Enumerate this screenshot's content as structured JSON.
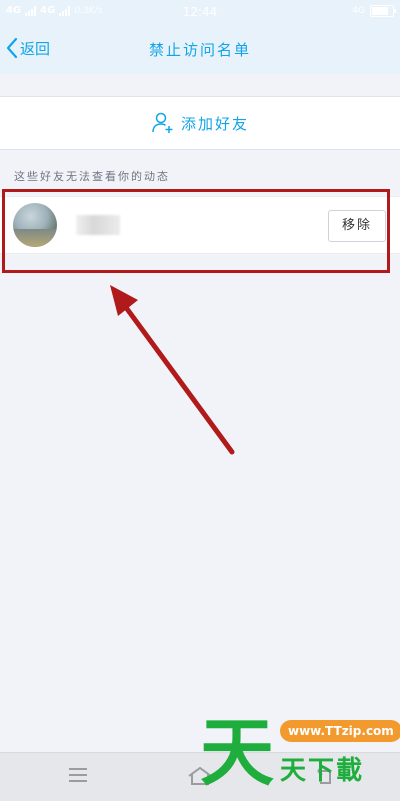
{
  "status_bar": {
    "network_1": "4G",
    "network_2": "4G",
    "speed": "0.3K/s",
    "time": "12:44",
    "right_label": "4G"
  },
  "nav": {
    "back_label": "返回",
    "title": "禁止访问名单"
  },
  "add_friend_label": "添加好友",
  "hint_text": "这些好友无法查看你的动态",
  "blocked_list": [
    {
      "remove_label": "移除"
    }
  ],
  "watermark": {
    "big_char": "天",
    "site": "www.TTzip.com",
    "text": "天下載"
  },
  "colors": {
    "accent": "#12a4e8",
    "highlight": "#b01a1a",
    "watermark_green": "#1fae3d",
    "watermark_orange": "#f29a2e"
  }
}
